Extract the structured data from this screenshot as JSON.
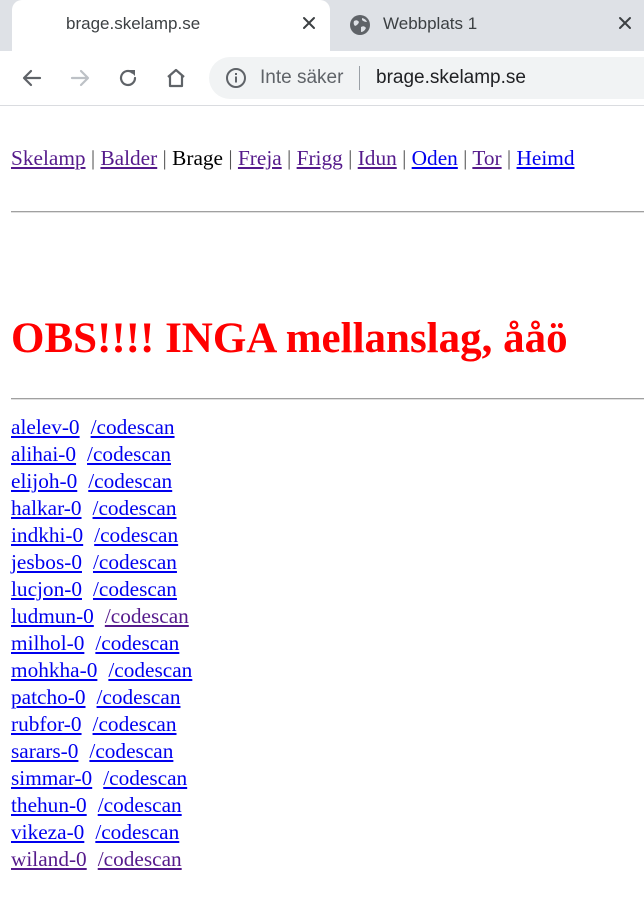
{
  "browser": {
    "tabs": [
      {
        "title": "brage.skelamp.se",
        "active": true
      },
      {
        "title": "Webbplats 1",
        "active": false
      }
    ],
    "omnibox": {
      "security_label": "Inte säker",
      "url": "brage.skelamp.se"
    },
    "icons": {
      "back": "arrow-left-icon",
      "forward": "arrow-right-icon",
      "reload": "reload-icon",
      "home": "home-icon",
      "info": "info-icon",
      "close": "close-icon",
      "favicon": "globe-icon"
    }
  },
  "page": {
    "nav": [
      {
        "label": "Skelamp",
        "link": true,
        "visited": true
      },
      {
        "label": "Balder",
        "link": true,
        "visited": true
      },
      {
        "label": "Brage",
        "link": false,
        "visited": false
      },
      {
        "label": "Freja",
        "link": true,
        "visited": true
      },
      {
        "label": "Frigg",
        "link": true,
        "visited": true
      },
      {
        "label": "Idun",
        "link": true,
        "visited": true
      },
      {
        "label": "Oden",
        "link": true,
        "visited": false
      },
      {
        "label": "Tor",
        "link": true,
        "visited": true
      },
      {
        "label": "Heimd",
        "link": true,
        "visited": false
      }
    ],
    "nav_separator": "|",
    "warning": "OBS!!!! INGA mellanslag, ååö",
    "warning_color": "#ff0000",
    "users": [
      {
        "name": "alelev-0",
        "scan": "/codescan",
        "name_visited": false,
        "scan_visited": false
      },
      {
        "name": "alihai-0",
        "scan": "/codescan",
        "name_visited": false,
        "scan_visited": false
      },
      {
        "name": "elijoh-0",
        "scan": "/codescan",
        "name_visited": false,
        "scan_visited": false
      },
      {
        "name": "halkar-0",
        "scan": "/codescan",
        "name_visited": false,
        "scan_visited": false
      },
      {
        "name": "indkhi-0",
        "scan": "/codescan",
        "name_visited": false,
        "scan_visited": false
      },
      {
        "name": "jesbos-0",
        "scan": "/codescan",
        "name_visited": false,
        "scan_visited": false
      },
      {
        "name": "lucjon-0",
        "scan": "/codescan",
        "name_visited": false,
        "scan_visited": false
      },
      {
        "name": "ludmun-0",
        "scan": "/codescan",
        "name_visited": false,
        "scan_visited": true
      },
      {
        "name": "milhol-0",
        "scan": "/codescan",
        "name_visited": false,
        "scan_visited": false
      },
      {
        "name": "mohkha-0",
        "scan": "/codescan",
        "name_visited": false,
        "scan_visited": false
      },
      {
        "name": "patcho-0",
        "scan": "/codescan",
        "name_visited": false,
        "scan_visited": false
      },
      {
        "name": "rubfor-0",
        "scan": "/codescan",
        "name_visited": false,
        "scan_visited": false
      },
      {
        "name": "sarars-0",
        "scan": "/codescan",
        "name_visited": false,
        "scan_visited": false
      },
      {
        "name": "simmar-0",
        "scan": "/codescan",
        "name_visited": false,
        "scan_visited": false
      },
      {
        "name": "thehun-0",
        "scan": "/codescan",
        "name_visited": false,
        "scan_visited": false
      },
      {
        "name": "vikeza-0",
        "scan": "/codescan",
        "name_visited": false,
        "scan_visited": false
      },
      {
        "name": "wiland-0",
        "scan": "/codescan",
        "name_visited": true,
        "scan_visited": true
      }
    ]
  }
}
